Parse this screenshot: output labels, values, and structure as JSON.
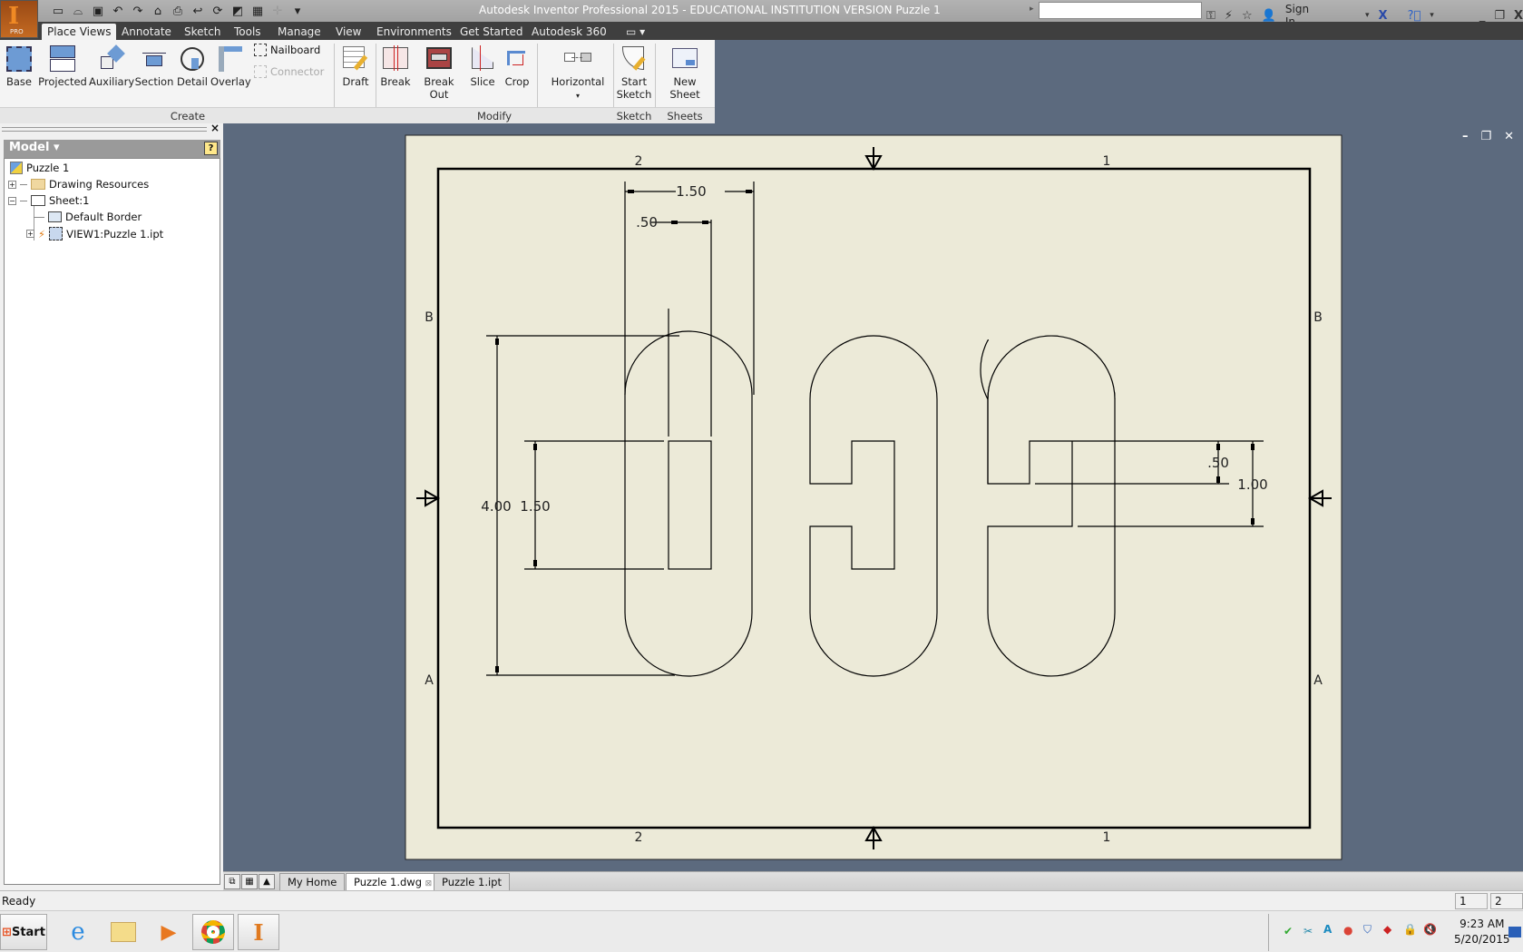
{
  "titlebar": {
    "title": "Autodesk Inventor Professional 2015 - EDUCATIONAL INSTITUTION VERSION    Puzzle 1",
    "app_badge": "PRO",
    "search_value": "",
    "sign_in": "Sign In",
    "quick_access": [
      "new-icon",
      "open-icon",
      "save-icon",
      "undo-icon",
      "redo-icon",
      "home-icon",
      "print-icon",
      "return-icon",
      "update-icon",
      "measure-icon",
      "appearance-icon",
      "add-icon",
      "customize-icon"
    ]
  },
  "ribbon": {
    "tabs": [
      "Place Views",
      "Annotate",
      "Sketch",
      "Tools",
      "Manage",
      "View",
      "Environments",
      "Get Started",
      "Autodesk 360"
    ],
    "active_tab": "Place Views",
    "create": {
      "label": "Create",
      "buttons": [
        "Base",
        "Projected",
        "Auxiliary",
        "Section",
        "Detail",
        "Overlay"
      ],
      "small": [
        "Nailboard",
        "Connector"
      ],
      "draft": "Draft"
    },
    "modify": {
      "label": "Modify",
      "buttons": [
        "Break",
        "Break Out",
        "Slice",
        "Crop"
      ],
      "horizontal": "Horizontal"
    },
    "sketch": {
      "label": "Sketch",
      "button_line1": "Start",
      "button_line2": "Sketch"
    },
    "sheets": {
      "label": "Sheets",
      "button": "New Sheet"
    }
  },
  "browser": {
    "header": "Model",
    "help": "?",
    "tree": [
      {
        "label": "Puzzle 1",
        "level": 0
      },
      {
        "label": "Drawing Resources",
        "level": 1,
        "expander": "+"
      },
      {
        "label": "Sheet:1",
        "level": 1,
        "expander": "−"
      },
      {
        "label": "Default Border",
        "level": 2
      },
      {
        "label": "VIEW1:Puzzle 1.ipt",
        "level": 2,
        "expander": "+"
      }
    ]
  },
  "drawing": {
    "zone_top": [
      "2",
      "1"
    ],
    "zone_side": [
      "B",
      "A"
    ],
    "dimensions": {
      "top_width": "1.50",
      "top_slot": ".50",
      "left_height": "4.00",
      "left_slot": "1.50",
      "right_small": ".50",
      "right_large": "1.00"
    }
  },
  "doc_tabs": {
    "tabs": [
      "My Home",
      "Puzzle 1.dwg",
      "Puzzle 1.ipt"
    ],
    "active": "Puzzle 1.dwg"
  },
  "status": {
    "text": "Ready",
    "panel1": "1",
    "panel2": "2"
  },
  "taskbar": {
    "start": "Start",
    "time": "9:23 AM",
    "date": "5/20/2015"
  }
}
